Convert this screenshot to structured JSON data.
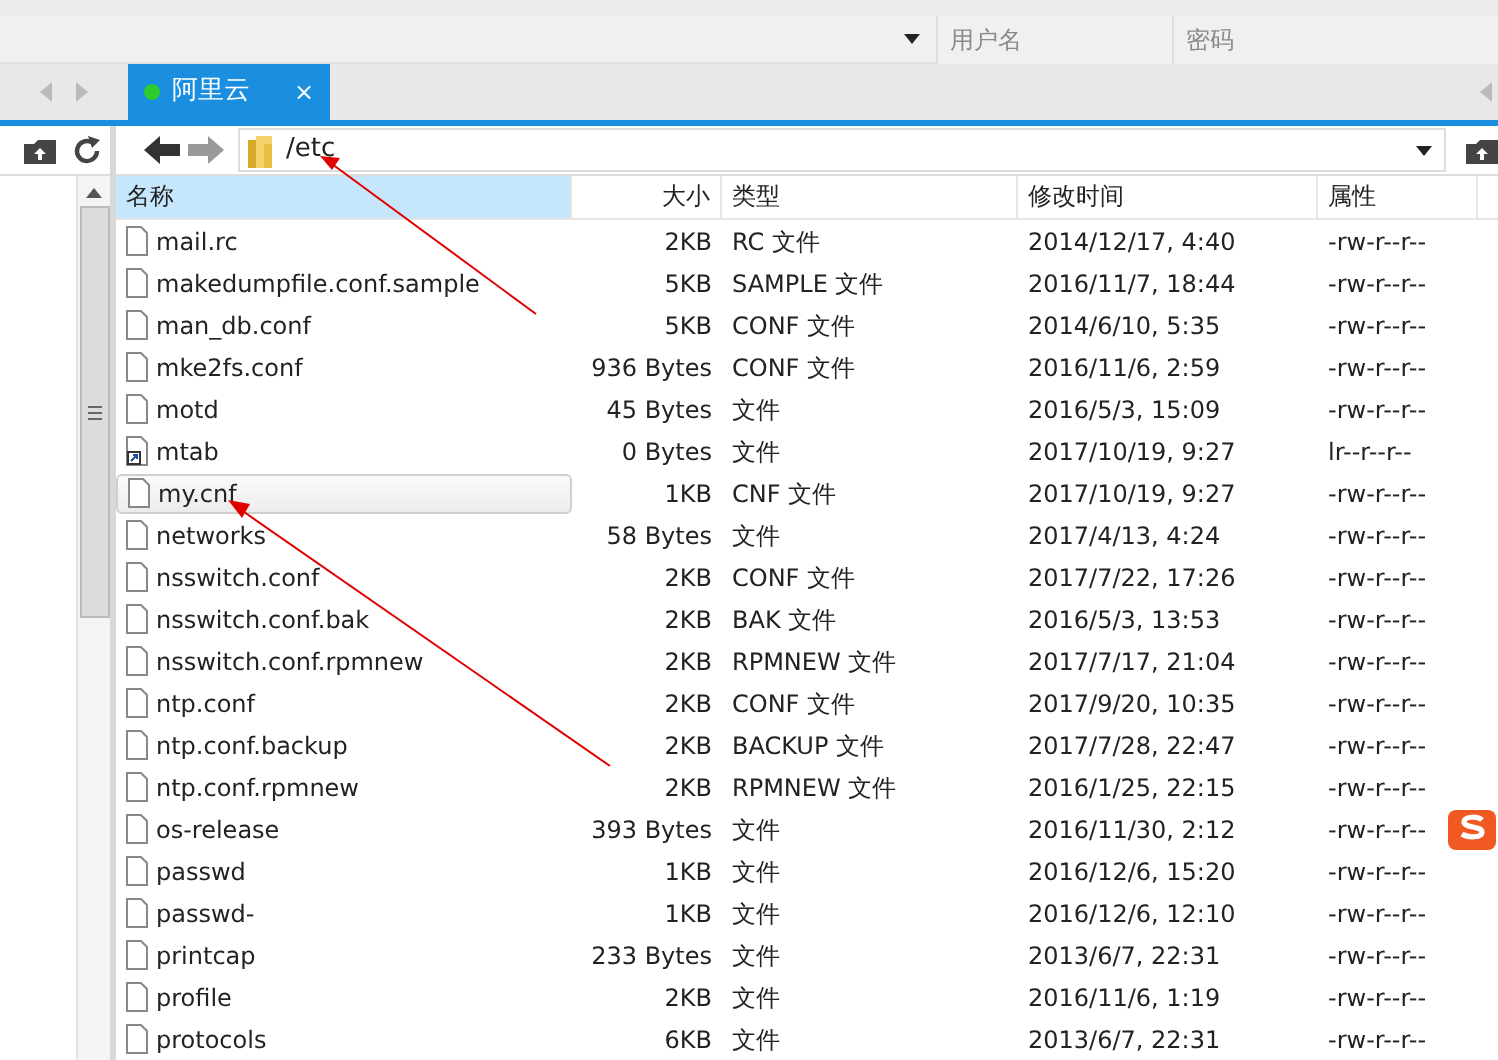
{
  "toolbar": {
    "username": {
      "placeholder": "用户名"
    },
    "password": {
      "placeholder": "密码"
    }
  },
  "tabs": [
    {
      "label": "阿里云",
      "selected": true,
      "connected": true,
      "close": "×"
    }
  ],
  "path": "/etc",
  "columns": [
    {
      "label": "名称",
      "selected": true
    },
    {
      "label": "大小",
      "selected": false
    },
    {
      "label": "类型",
      "selected": false
    },
    {
      "label": "修改时间",
      "selected": false
    },
    {
      "label": "属性",
      "selected": false
    }
  ],
  "files": [
    {
      "name": "mail.rc",
      "size": "2KB",
      "type": "RC 文件",
      "modified": "2014/12/17, 4:40",
      "attributes": "-rw-r--r--",
      "kind": "file",
      "hovered": false
    },
    {
      "name": "makedumpfile.conf.sample",
      "size": "5KB",
      "type": "SAMPLE 文件",
      "modified": "2016/11/7, 18:44",
      "attributes": "-rw-r--r--",
      "kind": "file",
      "hovered": false
    },
    {
      "name": "man_db.conf",
      "size": "5KB",
      "type": "CONF 文件",
      "modified": "2014/6/10, 5:35",
      "attributes": "-rw-r--r--",
      "kind": "file",
      "hovered": false
    },
    {
      "name": "mke2fs.conf",
      "size": "936 Bytes",
      "type": "CONF 文件",
      "modified": "2016/11/6, 2:59",
      "attributes": "-rw-r--r--",
      "kind": "file",
      "hovered": false
    },
    {
      "name": "motd",
      "size": "45 Bytes",
      "type": "文件",
      "modified": "2016/5/3, 15:09",
      "attributes": "-rw-r--r--",
      "kind": "file",
      "hovered": false
    },
    {
      "name": "mtab",
      "size": "0 Bytes",
      "type": "文件",
      "modified": "2017/10/19, 9:27",
      "attributes": "lr--r--r--",
      "kind": "link",
      "hovered": false
    },
    {
      "name": "my.cnf",
      "size": "1KB",
      "type": "CNF 文件",
      "modified": "2017/10/19, 9:27",
      "attributes": "-rw-r--r--",
      "kind": "file",
      "hovered": true
    },
    {
      "name": "networks",
      "size": "58 Bytes",
      "type": "文件",
      "modified": "2017/4/13, 4:24",
      "attributes": "-rw-r--r--",
      "kind": "file",
      "hovered": false
    },
    {
      "name": "nsswitch.conf",
      "size": "2KB",
      "type": "CONF 文件",
      "modified": "2017/7/22, 17:26",
      "attributes": "-rw-r--r--",
      "kind": "file",
      "hovered": false
    },
    {
      "name": "nsswitch.conf.bak",
      "size": "2KB",
      "type": "BAK 文件",
      "modified": "2016/5/3, 13:53",
      "attributes": "-rw-r--r--",
      "kind": "file",
      "hovered": false
    },
    {
      "name": "nsswitch.conf.rpmnew",
      "size": "2KB",
      "type": "RPMNEW 文件",
      "modified": "2017/7/17, 21:04",
      "attributes": "-rw-r--r--",
      "kind": "file",
      "hovered": false
    },
    {
      "name": "ntp.conf",
      "size": "2KB",
      "type": "CONF 文件",
      "modified": "2017/9/20, 10:35",
      "attributes": "-rw-r--r--",
      "kind": "file",
      "hovered": false
    },
    {
      "name": "ntp.conf.backup",
      "size": "2KB",
      "type": "BACKUP 文件",
      "modified": "2017/7/28, 22:47",
      "attributes": "-rw-r--r--",
      "kind": "file",
      "hovered": false
    },
    {
      "name": "ntp.conf.rpmnew",
      "size": "2KB",
      "type": "RPMNEW 文件",
      "modified": "2016/1/25, 22:15",
      "attributes": "-rw-r--r--",
      "kind": "file",
      "hovered": false
    },
    {
      "name": "os-release",
      "size": "393 Bytes",
      "type": "文件",
      "modified": "2016/11/30, 2:12",
      "attributes": "-rw-r--r--",
      "kind": "file",
      "hovered": false
    },
    {
      "name": "passwd",
      "size": "1KB",
      "type": "文件",
      "modified": "2016/12/6, 15:20",
      "attributes": "-rw-r--r--",
      "kind": "file",
      "hovered": false
    },
    {
      "name": "passwd-",
      "size": "1KB",
      "type": "文件",
      "modified": "2016/12/6, 12:10",
      "attributes": "-rw-r--r--",
      "kind": "file",
      "hovered": false
    },
    {
      "name": "printcap",
      "size": "233 Bytes",
      "type": "文件",
      "modified": "2013/6/7, 22:31",
      "attributes": "-rw-r--r--",
      "kind": "file",
      "hovered": false
    },
    {
      "name": "profile",
      "size": "2KB",
      "type": "文件",
      "modified": "2016/11/6, 1:19",
      "attributes": "-rw-r--r--",
      "kind": "file",
      "hovered": false
    },
    {
      "name": "protocols",
      "size": "6KB",
      "type": "文件",
      "modified": "2013/6/7, 22:31",
      "attributes": "-rw-r--r--",
      "kind": "file",
      "hovered": false
    }
  ]
}
